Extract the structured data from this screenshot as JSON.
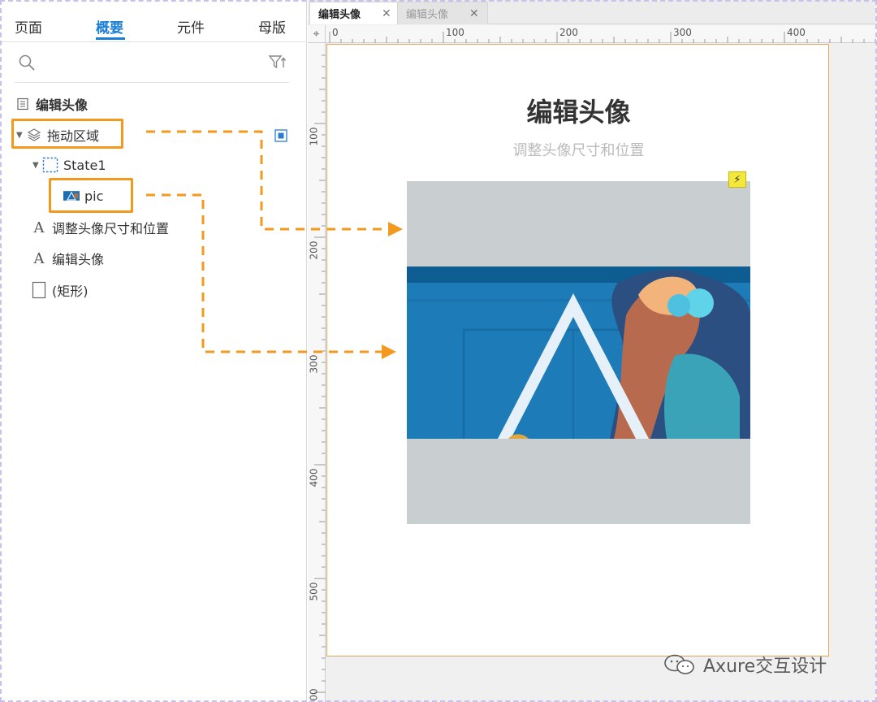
{
  "left_panel": {
    "tabs": [
      {
        "label": "页面"
      },
      {
        "label": "概要"
      },
      {
        "label": "元件"
      },
      {
        "label": "母版"
      }
    ],
    "active_tab": "概要",
    "outline": {
      "page_name": "编辑头像",
      "drag_area": "拖动区域",
      "state": "State1",
      "pic": "pic",
      "text_subtitle": "调整头像尺寸和位置",
      "text_title": "编辑头像",
      "rect": "(矩形)"
    }
  },
  "doc_tabs": [
    {
      "label": "编辑头像",
      "active": true
    },
    {
      "label": "编辑头像",
      "active": false
    }
  ],
  "rulers": {
    "top": [
      "0",
      "100",
      "200",
      "300",
      "400"
    ],
    "left": [
      "100",
      "200",
      "300",
      "400",
      "500",
      "00"
    ]
  },
  "canvas": {
    "title": "编辑头像",
    "subtitle": "调整头像尺寸和位置"
  },
  "watermark": "Axure交互设计",
  "colors": {
    "accent_blue": "#1a7fd4",
    "highlight_orange": "#f39a1e",
    "drag_area_gray": "#c9cfd1",
    "event_yellow": "#f4e83a"
  },
  "icons": {
    "search": "search-icon",
    "filter": "filter-sort-icon",
    "page": "page-icon",
    "layers": "layers-icon",
    "state": "state-icon",
    "image": "image-icon",
    "text": "text-icon",
    "rect": "rectangle-icon",
    "event": "lightning-icon"
  }
}
